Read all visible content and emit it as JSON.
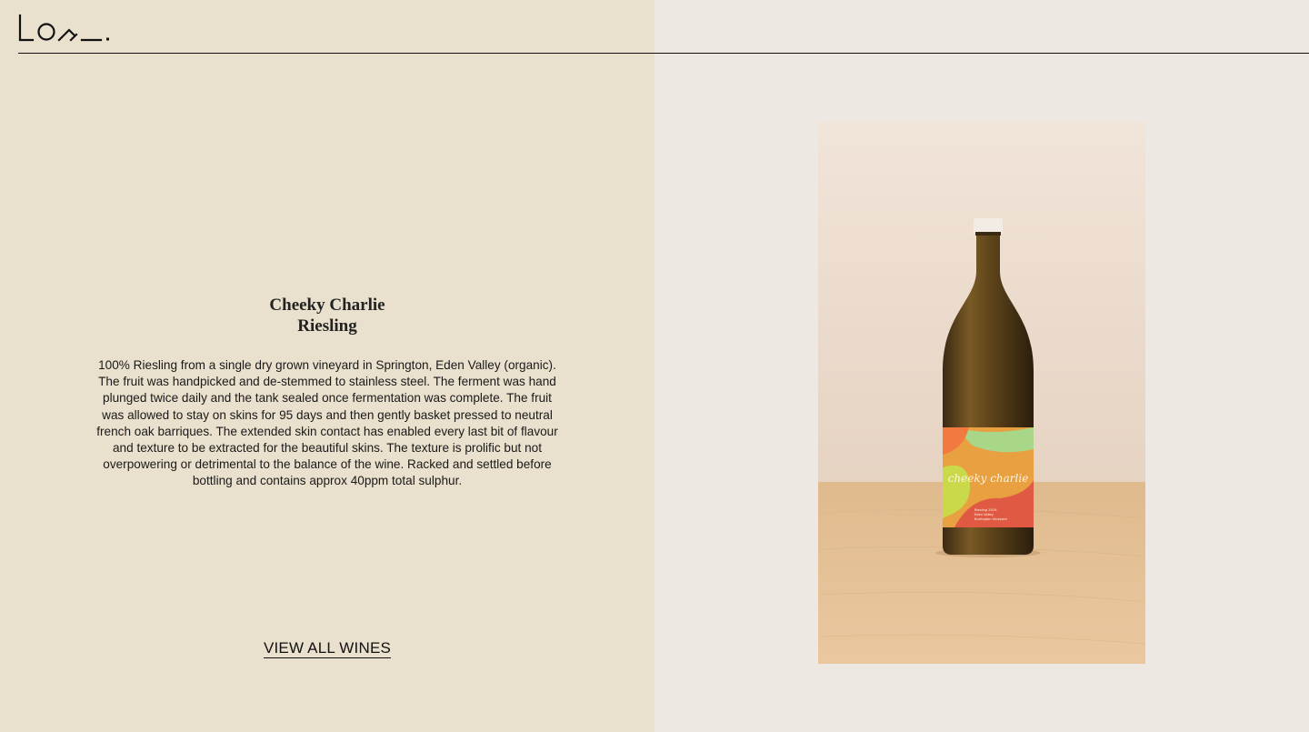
{
  "brand": {
    "logo_text": "Lo^_."
  },
  "product": {
    "name_line1": "Cheeky Charlie",
    "name_line2": "Riesling",
    "description": "100% Riesling from a single dry grown vineyard in Springton, Eden Valley (organic). The fruit was handpicked and de-stemmed to stainless steel. The ferment was hand plunged twice daily and the tank sealed once fermentation was complete. The fruit was allowed to stay on skins for 95 days and then gently basket pressed to neutral french oak barriques. The extended skin contact has enabled every last bit of flavour and texture to be extracted for the beautiful skins. The texture is prolific but not overpowering or detrimental to the balance of the wine. Racked and settled before bottling and contains approx 40ppm total sulphur.",
    "label_script": "cheeky charlie",
    "label_line1": "Riesling 2019",
    "label_line2": "Eden Valley",
    "label_line3": "Burlington Vineyard"
  },
  "cta": {
    "view_all_label": "VIEW ALL WINES"
  },
  "colors": {
    "left_bg": "#e9e0cd",
    "right_bg": "#ede8e1",
    "text": "#1a1a1a",
    "label_orange": "#e8a040",
    "label_red": "#e05a43",
    "label_green": "#a8d78a"
  }
}
